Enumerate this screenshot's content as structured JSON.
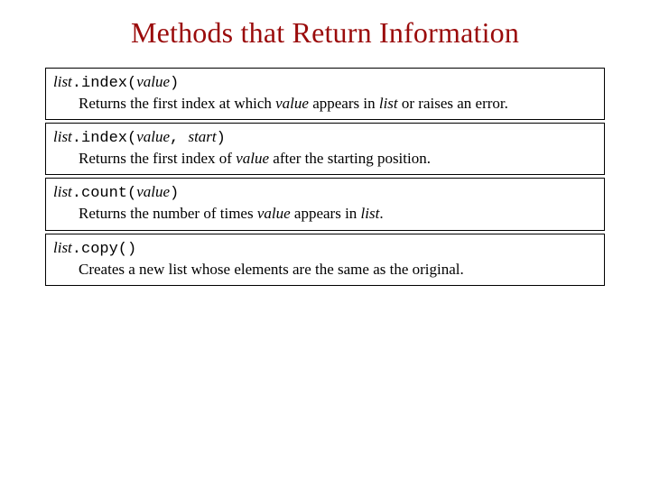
{
  "title": "Methods that Return Information",
  "methods": [
    {
      "sig_list": "list",
      "sig_open": ".index(",
      "sig_arg1": "value",
      "sig_sep": "",
      "sig_arg2": "",
      "sig_close": ")",
      "desc_pre": "Returns the first index at which ",
      "desc_i1": "value",
      "desc_mid": " appears in ",
      "desc_i2": "list",
      "desc_post": " or raises an error."
    },
    {
      "sig_list": "list",
      "sig_open": ".index(",
      "sig_arg1": "value",
      "sig_sep": ", ",
      "sig_arg2": "start",
      "sig_close": ")",
      "desc_pre": "Returns the first index of ",
      "desc_i1": "value",
      "desc_mid": " after the starting position.",
      "desc_i2": "",
      "desc_post": ""
    },
    {
      "sig_list": "list",
      "sig_open": ".count(",
      "sig_arg1": "value",
      "sig_sep": "",
      "sig_arg2": "",
      "sig_close": ")",
      "desc_pre": "Returns the number of times ",
      "desc_i1": "value",
      "desc_mid": " appears in ",
      "desc_i2": "list",
      "desc_post": "."
    },
    {
      "sig_list": "list",
      "sig_open": ".copy()",
      "sig_arg1": "",
      "sig_sep": "",
      "sig_arg2": "",
      "sig_close": "",
      "desc_pre": "Creates a new list whose elements are the same as the original.",
      "desc_i1": "",
      "desc_mid": "",
      "desc_i2": "",
      "desc_post": ""
    }
  ]
}
